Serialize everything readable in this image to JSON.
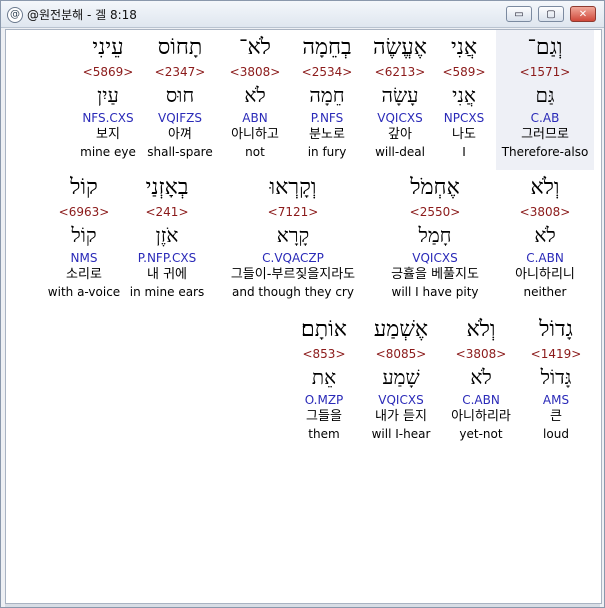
{
  "window": {
    "app_icon": "@",
    "title": "@원전분해 - 겔 8:18",
    "minimize": "▭",
    "maximize": "▢",
    "close": "✕"
  },
  "rows": [
    {
      "words": [
        {
          "heb": "וְגַם־",
          "strong": "<1571>",
          "lemma": "גַּם",
          "morph": "C.AB",
          "korean": "그러므로",
          "english": "Therefore-also",
          "highlight": true
        },
        {
          "heb": "אֲנִי",
          "strong": "<589>",
          "lemma": "אֲנִי",
          "morph": "NPCXS",
          "korean": "나도",
          "english": "I"
        },
        {
          "heb": "אֶעֱשֶׂה",
          "strong": "<6213>",
          "lemma": "עָשָׂה",
          "morph": "VQICXS",
          "korean": "갚아",
          "english": "will-deal"
        },
        {
          "heb": "בְחֵמָה",
          "strong": "<2534>",
          "lemma": "חֵמָה",
          "morph": "P.NFS",
          "korean": "분노로",
          "english": "in fury"
        },
        {
          "heb": "לֹא־",
          "strong": "<3808>",
          "lemma": "לֹא",
          "morph": "ABN",
          "korean": "아니하고",
          "english": "not"
        },
        {
          "heb": "תָחוֹס",
          "strong": "<2347>",
          "lemma": "חוּס",
          "morph": "VQIFZS",
          "korean": "아껴",
          "english": "shall-spare"
        },
        {
          "heb": "עֵינִי",
          "strong": "<5869>",
          "lemma": "עַיִן",
          "morph": "NFS.CXS",
          "korean": "보지",
          "english": "mine eye"
        }
      ]
    },
    {
      "words": [
        {
          "heb": "וְלֹא",
          "strong": "<3808>",
          "lemma": "לֹא",
          "morph": "C.ABN",
          "korean": "아니하리니",
          "english": "neither"
        },
        {
          "heb": "אֶחְמֹל",
          "strong": "<2550>",
          "lemma": "חָמַל",
          "morph": "VQICXS",
          "korean": "긍휼을 베풀지도",
          "english": "will I have pity"
        },
        {
          "heb": "וְקָרְאוּ",
          "strong": "<7121>",
          "lemma": "קָרָא",
          "morph": "C.VQACZP",
          "korean": "그들이-부르짖을지라도",
          "english": "and though they cry"
        },
        {
          "heb": "בְאָזְנַי",
          "strong": "<241>",
          "lemma": "אֹזֶן",
          "morph": "P.NFP.CXS",
          "korean": "내 귀에",
          "english": "in mine ears"
        },
        {
          "heb": "קוֹל",
          "strong": "<6963>",
          "lemma": "קוֹל",
          "morph": "NMS",
          "korean": "소리로",
          "english": "with a-voice"
        }
      ]
    },
    {
      "words": [
        {
          "heb": "גָדוֹל",
          "strong": "<1419>",
          "lemma": "גָּדוֹל",
          "morph": "AMS",
          "korean": "큰",
          "english": "loud"
        },
        {
          "heb": "וְלֹא",
          "strong": "<3808>",
          "lemma": "לֹא",
          "morph": "C.ABN",
          "korean": "아니하리라",
          "english": "yet-not"
        },
        {
          "heb": "אֶשְׁמַע",
          "strong": "<8085>",
          "lemma": "שָׁמַע",
          "morph": "VQICXS",
          "korean": "내가 듣지",
          "english": "will I-hear"
        },
        {
          "heb": "אוֹתָם׃",
          "strong": "<853>",
          "lemma": "אֵת",
          "morph": "O.MZP",
          "korean": "그들을",
          "english": "them"
        }
      ]
    }
  ]
}
